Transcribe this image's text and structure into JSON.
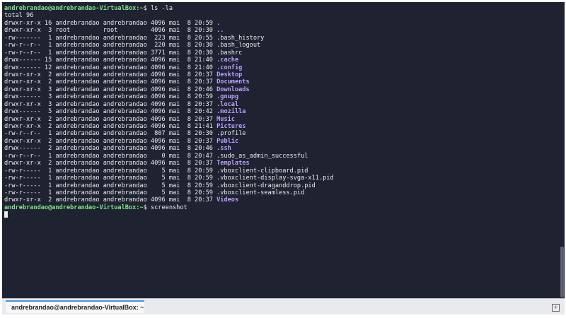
{
  "terminal": {
    "lines": [
      [
        {
          "t": "andrebrandao@andrebrandao-VirtualBox:~",
          "c": "user"
        },
        {
          "t": "$ ls -la",
          "c": "text"
        }
      ],
      [
        {
          "t": "total 96",
          "c": "text"
        }
      ],
      [
        {
          "t": "drwxr-xr-x 16 andrebrandao andrebrandao 4096 mai  8 20:59 ",
          "c": "text"
        },
        {
          "t": ".",
          "c": "dir"
        }
      ],
      [
        {
          "t": "drwxr-xr-x  3 root         root         4096 mai  8 20:30 ",
          "c": "text"
        },
        {
          "t": "..",
          "c": "dir"
        }
      ],
      [
        {
          "t": "-rw-------  1 andrebrandao andrebrandao  223 mai  8 20:55 .bash_history",
          "c": "text"
        }
      ],
      [
        {
          "t": "-rw-r--r--  1 andrebrandao andrebrandao  220 mai  8 20:30 .bash_logout",
          "c": "text"
        }
      ],
      [
        {
          "t": "-rw-r--r--  1 andrebrandao andrebrandao 3771 mai  8 20:30 .bashrc",
          "c": "text"
        }
      ],
      [
        {
          "t": "drwx------ 15 andrebrandao andrebrandao 4096 mai  8 21:40 ",
          "c": "text"
        },
        {
          "t": ".cache",
          "c": "dir"
        }
      ],
      [
        {
          "t": "drwx------ 12 andrebrandao andrebrandao 4096 mai  8 21:40 ",
          "c": "text"
        },
        {
          "t": ".config",
          "c": "dir"
        }
      ],
      [
        {
          "t": "drwxr-xr-x  2 andrebrandao andrebrandao 4096 mai  8 20:37 ",
          "c": "text"
        },
        {
          "t": "Desktop",
          "c": "dir"
        }
      ],
      [
        {
          "t": "drwxr-xr-x  2 andrebrandao andrebrandao 4096 mai  8 20:37 ",
          "c": "text"
        },
        {
          "t": "Documents",
          "c": "dir"
        }
      ],
      [
        {
          "t": "drwxr-xr-x  3 andrebrandao andrebrandao 4096 mai  8 20:46 ",
          "c": "text"
        },
        {
          "t": "Downloads",
          "c": "dir"
        }
      ],
      [
        {
          "t": "drwx------  3 andrebrandao andrebrandao 4096 mai  8 20:59 ",
          "c": "text"
        },
        {
          "t": ".gnupg",
          "c": "dir"
        }
      ],
      [
        {
          "t": "drwxr-xr-x  3 andrebrandao andrebrandao 4096 mai  8 20:37 ",
          "c": "text"
        },
        {
          "t": ".local",
          "c": "dir"
        }
      ],
      [
        {
          "t": "drwx------  5 andrebrandao andrebrandao 4096 mai  8 20:42 ",
          "c": "text"
        },
        {
          "t": ".mozilla",
          "c": "dir"
        }
      ],
      [
        {
          "t": "drwxr-xr-x  2 andrebrandao andrebrandao 4096 mai  8 20:37 ",
          "c": "text"
        },
        {
          "t": "Music",
          "c": "dir"
        }
      ],
      [
        {
          "t": "drwxr-xr-x  2 andrebrandao andrebrandao 4096 mai  8 21:41 ",
          "c": "text"
        },
        {
          "t": "Pictures",
          "c": "dir"
        }
      ],
      [
        {
          "t": "-rw-r--r--  1 andrebrandao andrebrandao  807 mai  8 20:30 .profile",
          "c": "text"
        }
      ],
      [
        {
          "t": "drwxr-xr-x  2 andrebrandao andrebrandao 4096 mai  8 20:37 ",
          "c": "text"
        },
        {
          "t": "Public",
          "c": "dir"
        }
      ],
      [
        {
          "t": "drwx------  2 andrebrandao andrebrandao 4096 mai  8 20:46 ",
          "c": "text"
        },
        {
          "t": ".ssh",
          "c": "dir"
        }
      ],
      [
        {
          "t": "-rw-r--r--  1 andrebrandao andrebrandao    0 mai  8 20:47 .sudo_as_admin_successful",
          "c": "text"
        }
      ],
      [
        {
          "t": "drwxr-xr-x  2 andrebrandao andrebrandao 4096 mai  8 20:37 ",
          "c": "text"
        },
        {
          "t": "Templates",
          "c": "dir"
        }
      ],
      [
        {
          "t": "-rw-r-----  1 andrebrandao andrebrandao    5 mai  8 20:59 .vboxclient-clipboard.pid",
          "c": "text"
        }
      ],
      [
        {
          "t": "-rw-r-----  1 andrebrandao andrebrandao    5 mai  8 20:59 .vboxclient-display-svga-x11.pid",
          "c": "text"
        }
      ],
      [
        {
          "t": "-rw-r-----  1 andrebrandao andrebrandao    5 mai  8 20:59 .vboxclient-draganddrop.pid",
          "c": "text"
        }
      ],
      [
        {
          "t": "-rw-r-----  1 andrebrandao andrebrandao    5 mai  8 20:59 .vboxclient-seamless.pid",
          "c": "text"
        }
      ],
      [
        {
          "t": "drwxr-xr-x  2 andrebrandao andrebrandao 4096 mai  8 20:37 ",
          "c": "text"
        },
        {
          "t": "Videos",
          "c": "dir"
        }
      ],
      [
        {
          "t": "andrebrandao@andrebrandao-VirtualBox:~",
          "c": "user"
        },
        {
          "t": "$ screenshot",
          "c": "text"
        }
      ]
    ]
  },
  "tab": {
    "label": "andrebrandao@andrebrandao-VirtualBox: ~",
    "new_tab_icon": "new-tab-icon"
  },
  "colors": {
    "background": "#1f2230",
    "text": "#e9ecef",
    "prompt": "#7ee38a",
    "directory": "#b9a0ff",
    "tab_accent": "#4d8fe5"
  }
}
